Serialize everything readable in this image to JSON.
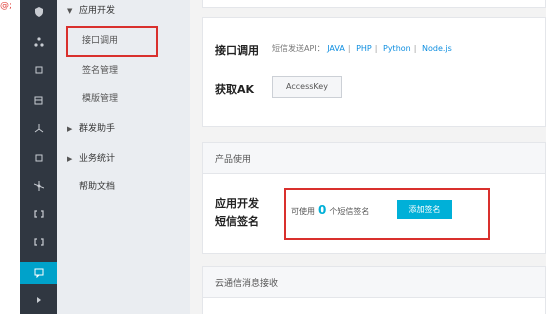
{
  "corner": {
    "glyph": "@;"
  },
  "sidebar": {
    "items": [
      {
        "label": "应用开发",
        "caret": "▼"
      },
      {
        "label": "接口调用"
      },
      {
        "label": "签名管理"
      },
      {
        "label": "模版管理"
      },
      {
        "label": "群发助手",
        "caret": "▶"
      },
      {
        "label": "业务统计",
        "caret": "▶"
      },
      {
        "label": "帮助文档"
      }
    ]
  },
  "api": {
    "label": "接口调用",
    "prefix": "短信发送API：",
    "links": [
      "JAVA",
      "PHP",
      "Python",
      "Node.js"
    ]
  },
  "ak": {
    "label": "获取AK",
    "button": "AccessKey"
  },
  "product": {
    "heading": "产品使用",
    "title_line1": "应用开发",
    "title_line2": "短信签名",
    "available_prefix": "可使用",
    "count": "0",
    "available_suffix": "个短信签名",
    "add_button": "添加签名"
  },
  "cloud": {
    "heading": "云通信消息接收"
  }
}
